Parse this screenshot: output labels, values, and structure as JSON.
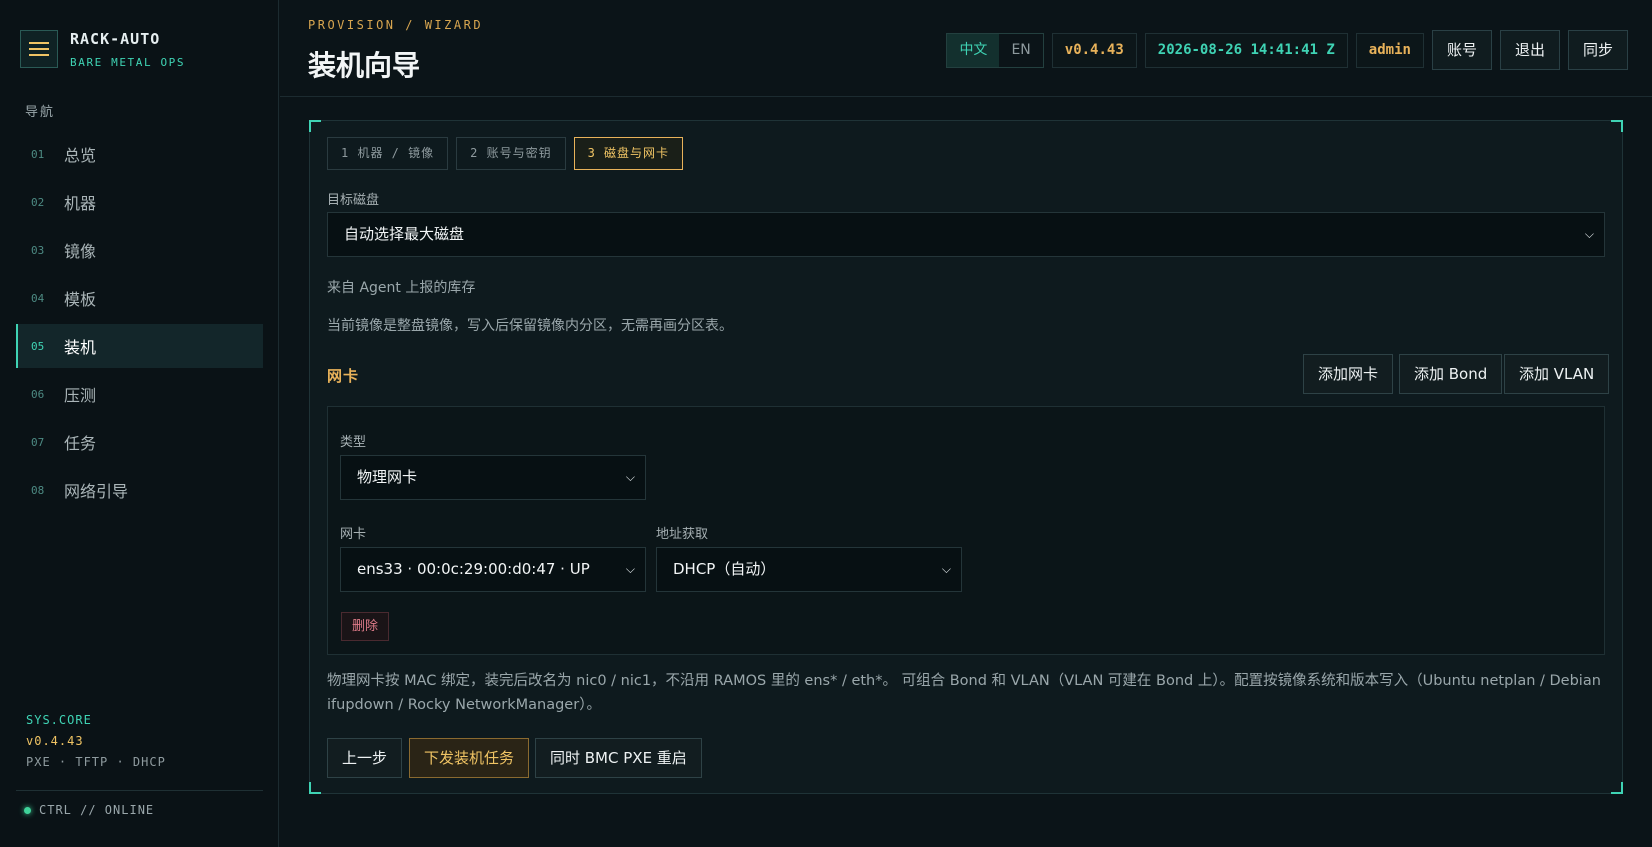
{
  "sidebar": {
    "brand_title": "RACK-AUTO",
    "brand_sub": "BARE METAL OPS",
    "nav_title": "导航",
    "items": [
      {
        "num": "01",
        "label": "总览"
      },
      {
        "num": "02",
        "label": "机器"
      },
      {
        "num": "03",
        "label": "镜像"
      },
      {
        "num": "04",
        "label": "模板"
      },
      {
        "num": "05",
        "label": "装机",
        "active": true
      },
      {
        "num": "06",
        "label": "压测"
      },
      {
        "num": "07",
        "label": "任务"
      },
      {
        "num": "08",
        "label": "网络引导"
      }
    ],
    "sys_core": "SYS.CORE",
    "sys_version": "v0.4.43",
    "sys_services": "PXE · TFTP · DHCP",
    "status": "CTRL // ONLINE"
  },
  "header": {
    "breadcrumb": "PROVISION / WIZARD",
    "title": "装机向导",
    "lang_zh": "中文",
    "lang_en": "EN",
    "version": "v0.4.43",
    "datetime": "2026-08-26 14:41:41 Z",
    "user": "admin",
    "account_label": "账号",
    "logout_label": "退出",
    "sync_label": "同步"
  },
  "wizard": {
    "steps": [
      "1 机器 / 镜像",
      "2 账号与密钥",
      "3 磁盘与网卡"
    ],
    "active_step": 3,
    "disk_label": "目标磁盘",
    "disk_value": "自动选择最大磁盘",
    "disk_hint": "来自 Agent 上报的库存",
    "image_note": "当前镜像是整盘镜像，写入后保留镜像内分区，无需再画分区表。",
    "nic_section": "网卡",
    "add_nic": "添加网卡",
    "add_bond": "添加 Bond",
    "add_vlan": "添加 VLAN",
    "nic": {
      "type_label": "类型",
      "type_value": "物理网卡",
      "nic_label": "网卡",
      "nic_value": "ens33 · 00:0c:29:00:d0:47 · UP",
      "addr_label": "地址获取",
      "addr_value": "DHCP（自动）",
      "delete_label": "删除"
    },
    "footer_note": "物理网卡按 MAC 绑定，装完后改名为 nic0 / nic1，不沿用 RAMOS 里的 ens* / eth*。 可组合 Bond 和 VLAN（VLAN 可建在 Bond 上）。配置按镜像系统和版本写入（Ubuntu netplan / Debian ifupdown / Rocky NetworkManager）。",
    "prev_label": "上一步",
    "submit_label": "下发装机任务",
    "bmc_label": "同时 BMC PXE 重启"
  },
  "colors": {
    "accent": "#3fd3b4",
    "highlight": "#e8b25a",
    "danger": "#e07c8a"
  }
}
